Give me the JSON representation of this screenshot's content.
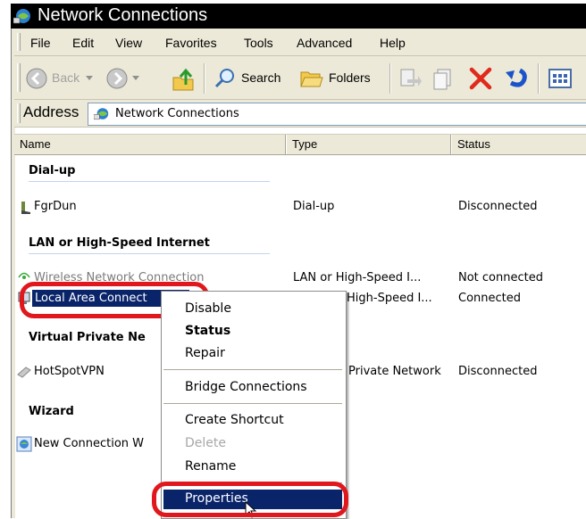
{
  "window": {
    "title": "Network Connections"
  },
  "menu": [
    "File",
    "Edit",
    "View",
    "Favorites",
    "Tools",
    "Advanced",
    "Help"
  ],
  "toolbar": {
    "back_label": "Back",
    "search_label": "Search",
    "folders_label": "Folders"
  },
  "address": {
    "label": "Address",
    "value": "Network Connections"
  },
  "columns": {
    "name": "Name",
    "type": "Type",
    "status": "Status"
  },
  "groups": {
    "dialup": "Dial-up",
    "lan": "LAN or High-Speed Internet",
    "vpn": "Virtual Private Ne",
    "wizard": "Wizard"
  },
  "rows": {
    "fgrdun": {
      "name": "FgrDun",
      "type": "Dial-up",
      "status": "Disconnected"
    },
    "wireless": {
      "name": "Wireless Network Connection",
      "type": "LAN or High-Speed I...",
      "status": "Not connected"
    },
    "local": {
      "name": "Local Area Connect",
      "type": "High-Speed I...",
      "status": "Connected"
    },
    "vpn": {
      "name": "HotSpotVPN",
      "type": "Private Network",
      "status": "Disconnected"
    },
    "wizard": {
      "name": "New Connection W"
    }
  },
  "context_menu": {
    "disable": "Disable",
    "status": "Status",
    "repair": "Repair",
    "bridge": "Bridge Connections",
    "shortcut": "Create Shortcut",
    "delete": "Delete",
    "rename": "Rename",
    "properties": "Properties"
  },
  "colors": {
    "highlight": "#0a246a",
    "annotation": "#e0181e",
    "chrome": "#ece9d8"
  }
}
